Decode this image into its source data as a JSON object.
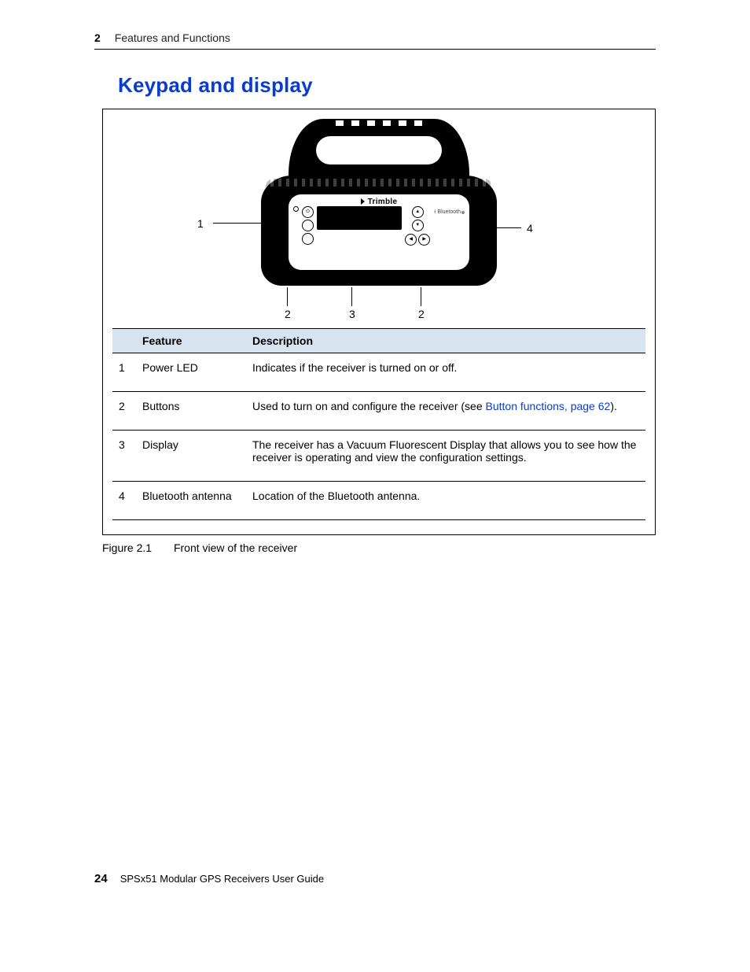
{
  "header": {
    "chapter_num": "2",
    "chapter_title": "Features and Functions"
  },
  "section": {
    "title": "Keypad and display"
  },
  "callouts": {
    "c1": "1",
    "c2a": "2",
    "c2b": "2",
    "c3": "3",
    "c4": "4"
  },
  "brand": "Trimble",
  "bluetooth_label": "Bluetooth",
  "table": {
    "head_feature": "Feature",
    "head_description": "Description",
    "rows": [
      {
        "n": "1",
        "feature": "Power LED",
        "desc": "Indicates if the receiver is turned on or off."
      },
      {
        "n": "2",
        "feature": "Buttons",
        "desc_pre": "Used to turn on and configure the receiver (see ",
        "link": "Button functions, page 62",
        "desc_post": ")."
      },
      {
        "n": "3",
        "feature": "Display",
        "desc": "The receiver has a Vacuum Fluorescent Display that allows you to see how the receiver is operating and view the configuration settings."
      },
      {
        "n": "4",
        "feature": "Bluetooth antenna",
        "desc": "Location of the Bluetooth antenna."
      }
    ]
  },
  "figure": {
    "number": "Figure 2.1",
    "caption": "Front view of the receiver"
  },
  "footer": {
    "page": "24",
    "guide": "SPSx51 Modular GPS Receivers User Guide"
  }
}
